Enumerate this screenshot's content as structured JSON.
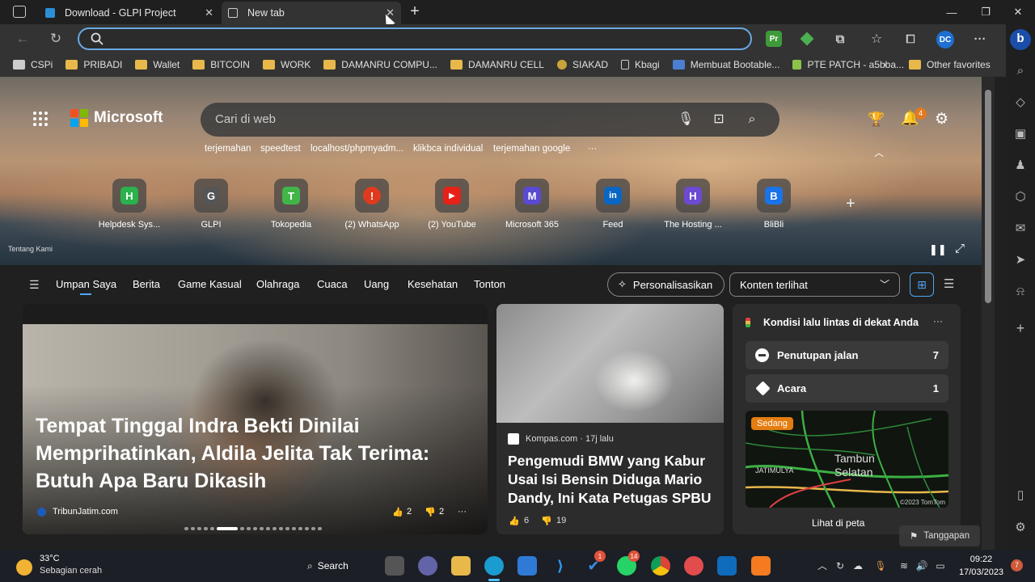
{
  "browser": {
    "tabs": [
      {
        "label": "Download - GLPI Project",
        "active": false
      },
      {
        "label": "New tab",
        "active": true
      }
    ],
    "address": {
      "value": "",
      "placeholder": ""
    },
    "extensions": [
      "Pr",
      "DC"
    ],
    "bookmarks": [
      "CSPi",
      "PRIBADI",
      "Wallet",
      "BITCOIN",
      "WORK",
      "DAMANRU COMPU...",
      "DAMANRU CELL",
      "SIAKAD",
      "Kbagi",
      "Membuat Bootable...",
      "PTE PATCH - a5bba..."
    ],
    "other_favorites": "Other favorites"
  },
  "newtab": {
    "brand": "Microsoft",
    "search_placeholder": "Cari di web",
    "quick_links": [
      "terjemahan",
      "speedtest",
      "localhost/phpmyadm...",
      "klikbca individual",
      "terjemahan google"
    ],
    "more_quick": "···",
    "tiles": [
      {
        "label": "Helpdesk Sys...",
        "glyph": "H",
        "color": "#2bb24c"
      },
      {
        "label": "GLPI",
        "glyph": "G",
        "color": "#555555"
      },
      {
        "label": "Tokopedia",
        "glyph": "T",
        "color": "#42b549"
      },
      {
        "label": "(2) WhatsApp",
        "glyph": "!",
        "color": "#e03a1e"
      },
      {
        "label": "(2) YouTube",
        "glyph": "▶",
        "color": "#e62117"
      },
      {
        "label": "Microsoft 365",
        "glyph": "M",
        "color": "#5a4ad1"
      },
      {
        "label": "Feed",
        "glyph": "in",
        "color": "#0a66c2"
      },
      {
        "label": "The Hosting ...",
        "glyph": "H",
        "color": "#6c4ad1"
      },
      {
        "label": "BliBli",
        "glyph": "B",
        "color": "#1a73e8"
      }
    ],
    "notifications_count": "4",
    "tentang": "Tentang Kami"
  },
  "feed_nav": {
    "items": [
      "Umpan Saya",
      "Berita",
      "Game Kasual",
      "Olahraga",
      "Cuaca",
      "Uang",
      "Kesehatan",
      "Tonton"
    ],
    "personalize": "Personalisasikan",
    "content_select": "Konten terlihat"
  },
  "cards": {
    "main": {
      "title": "Tempat Tinggal Indra Bekti Dinilai Memprihatinkan, Aldila Jelita Tak Terima: Butuh Apa Baru Dikasih",
      "source": "TribunJatim.com",
      "likes": "2",
      "dislikes": "2"
    },
    "second": {
      "source": "Kompas.com · 17j lalu",
      "title": "Pengemudi BMW yang Kabur Usai Isi Bensin Diduga Mario Dandy, Ini Kata Petugas SPBU",
      "likes": "6",
      "dislikes": "19"
    },
    "traffic": {
      "header": "Kondisi lalu lintas di dekat Anda",
      "rows": [
        {
          "label": "Penutupan jalan",
          "value": "7"
        },
        {
          "label": "Acara",
          "value": "1"
        }
      ],
      "badge": "Sedang",
      "map_places": [
        "Tambun",
        "Selatan",
        "JATIMULYA"
      ],
      "map_copyright": "©2023 TomTom",
      "map_button": "Lihat di peta"
    },
    "feedback": "Tanggapan"
  },
  "taskbar": {
    "temperature": "33°C",
    "weather": "Sebagian cerah",
    "search": "Search",
    "badges": [
      "1",
      "14"
    ],
    "time": "09:22",
    "date": "17/03/2023",
    "notif": "7"
  }
}
